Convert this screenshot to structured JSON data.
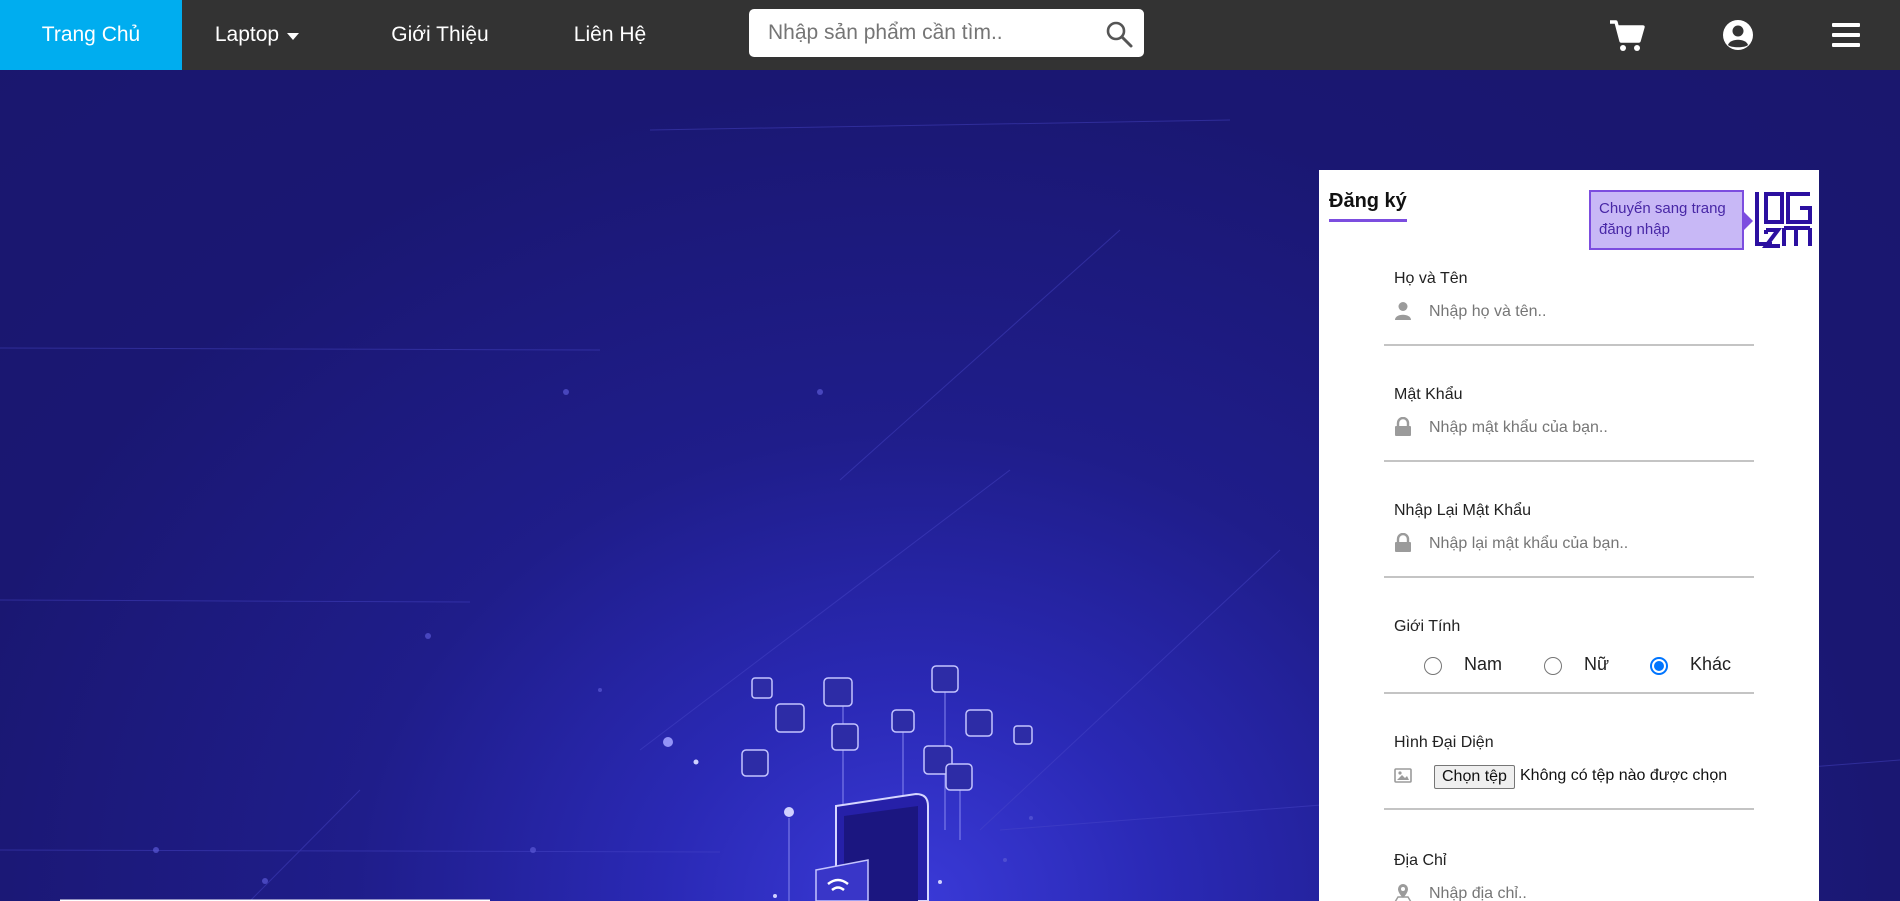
{
  "nav": {
    "home": "Trang Chủ",
    "laptop": "Laptop",
    "about": "Giới Thiệu",
    "contact": "Liên Hệ"
  },
  "search": {
    "placeholder": "Nhập sản phẩm cần tìm..",
    "value": ""
  },
  "icons": {
    "search": "search-icon",
    "cart": "cart-icon",
    "user": "user-circle-icon",
    "menu": "hamburger-menu-icon"
  },
  "colors": {
    "navbar": "#333333",
    "home_active": "#00adef",
    "background": "#1b1873",
    "accent": "#7c4ddf",
    "tooltip_bg": "#c8b8f6",
    "radio_checked": "#0075ff"
  },
  "register": {
    "title": "Đăng ký",
    "switch_tooltip": "Chuyển sang trang đăng nhập",
    "fields": [
      {
        "label": "Họ và Tên",
        "placeholder": "Nhập họ và tên..",
        "icon": "user-icon"
      },
      {
        "label": "Mật Khẩu",
        "placeholder": "Nhập mật khẩu của bạn..",
        "icon": "lock-icon"
      },
      {
        "label": "Nhập Lại Mật Khẩu",
        "placeholder": "Nhập lại mật khẩu của bạn..",
        "icon": "lock-icon"
      }
    ],
    "gender": {
      "label": "Giới Tính",
      "options": [
        "Nam",
        "Nữ",
        "Khác"
      ],
      "selected": "Khác"
    },
    "avatar": {
      "label": "Hình Đại Diện",
      "button": "Chọn tệp",
      "status": "Không có tệp nào được chọn",
      "icon": "image-icon"
    },
    "address": {
      "label": "Địa Chỉ",
      "placeholder": "Nhập địa chỉ..",
      "icon": "map-marker-icon"
    }
  }
}
